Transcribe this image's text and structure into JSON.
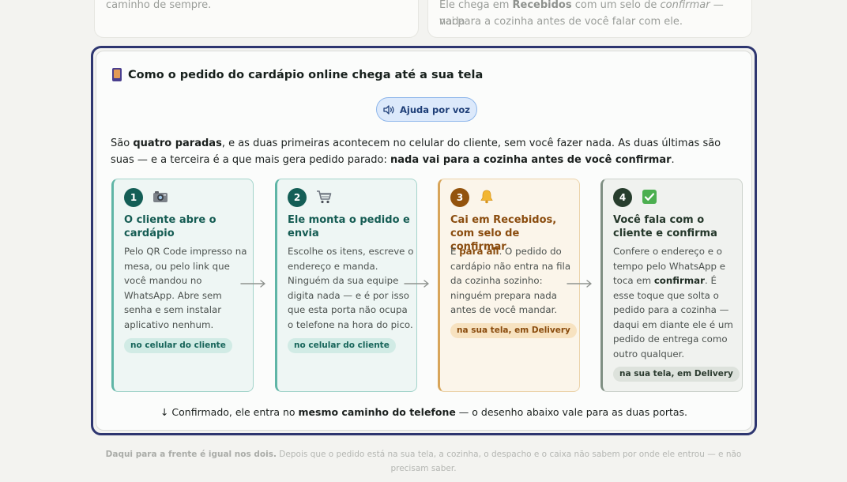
{
  "top_cards": {
    "left_line": "caminho de sempre.",
    "right_line1_pre": "Ele chega em ",
    "right_line1_bold": "Recebidos",
    "right_line1_mid": " com um selo de ",
    "right_line1_italic": "confirmar",
    "right_line1_post": " — nada",
    "right_line2": "vai para a cozinha antes de você falar com ele."
  },
  "card": {
    "icon": "mobile-phone-icon",
    "title": "Como o pedido do cardápio online chega até a sua tela",
    "help_button": "Ajuda por voz",
    "intro": {
      "p1": "São ",
      "b1": "quatro paradas",
      "p2": ", e as duas primeiras acontecem no celular do cliente, sem você fazer nada. As duas últimas são suas — e a terceira é a que mais gera pedido parado: ",
      "b2": "nada vai para a cozinha antes de você confirmar",
      "p3": "."
    }
  },
  "steps": [
    {
      "num": "1",
      "icon": "camera-icon",
      "title": "O cliente abre o cardápio",
      "body": "Pelo QR Code impresso na mesa, ou pelo link que você mandou no WhatsApp. Abre sem senha e sem instalar aplicativo nenhum.",
      "tag": "no celular do cliente"
    },
    {
      "num": "2",
      "icon": "cart-icon",
      "title": "Ele monta o pedido e envia",
      "body": "Escolhe os itens, escreve o endereço e manda. Ninguém da sua equipe digita nada — e é por isso que esta porta não ocupa o telefone na hora do pico.",
      "tag": "no celular do cliente"
    },
    {
      "num": "3",
      "icon": "bell-icon",
      "title": "Cai em Recebidos, com selo de confirmar",
      "body_pre": "E ",
      "body_bold": "para ali",
      "body_post": ". O pedido do cardápio não entra na fila da cozinha sozinho: ninguém prepara nada antes de você mandar.",
      "tag": "na sua tela, em Delivery"
    },
    {
      "num": "4",
      "icon": "check-mark-icon",
      "title": "Você fala com o cliente e confirma",
      "body_pre": "Confere o endereço e o tempo pelo WhatsApp e toca em ",
      "body_bold": "confirmar",
      "body_post": ". É esse toque que solta o pedido para a cozinha — daqui em diante ele é um pedido de entrega como outro qualquer.",
      "tag": "na sua tela, em Delivery"
    }
  ],
  "footer": {
    "pre": "↓ Confirmado, ele entra no ",
    "bold": "mesmo caminho do telefone",
    "post": " — o desenho abaixo vale para as duas portas."
  },
  "below": {
    "bold": "Daqui para a frente é igual nos dois.",
    "rest": " Depois que o pedido está na sua tela, a cozinha, o despacho e o caixa não sabem por onde ele entrou — e não precisam saber."
  },
  "colors": {
    "frame": "#2e3670",
    "teal": "#145e56",
    "amber": "#93530d",
    "dark_green": "#273d2d",
    "help_bg": "#dce9fb"
  }
}
